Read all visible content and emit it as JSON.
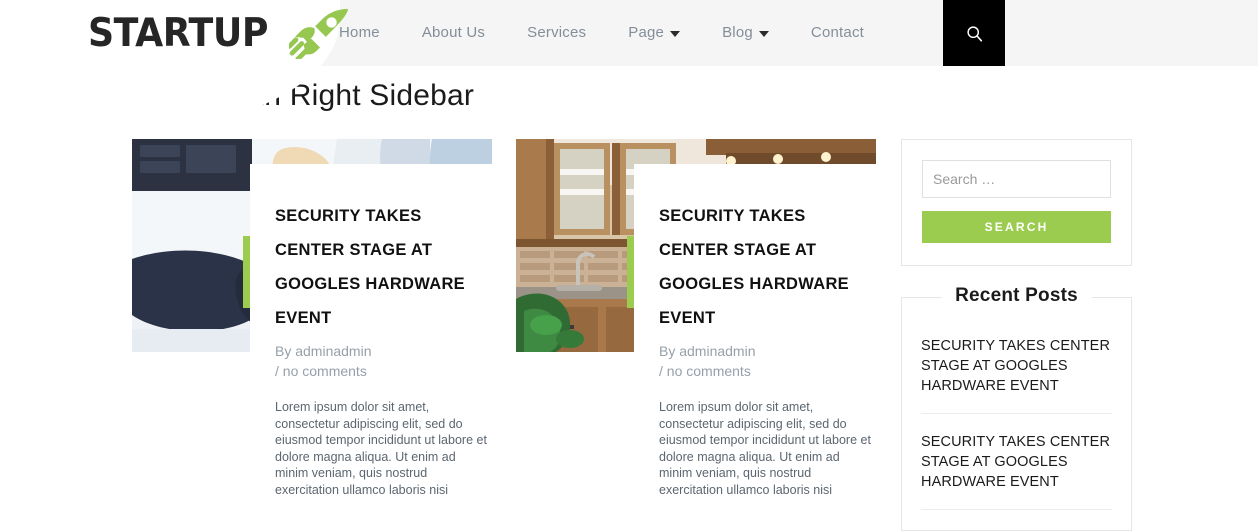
{
  "header": {
    "logo_text": "STARTUP",
    "logo_icon": "rocket-icon",
    "nav": [
      {
        "label": "Home",
        "has_dropdown": false
      },
      {
        "label": "About Us",
        "has_dropdown": false
      },
      {
        "label": "Services",
        "has_dropdown": false
      },
      {
        "label": "Page",
        "has_dropdown": true
      },
      {
        "label": "Blog",
        "has_dropdown": true
      },
      {
        "label": "Contact",
        "has_dropdown": false
      }
    ],
    "search_icon": "search-icon",
    "background_color": "#F5F5F5",
    "search_button_color": "#000000"
  },
  "page": {
    "title": "Blog With Right Sidebar",
    "accent_color": "#9BCC50"
  },
  "posts": [
    {
      "image": "business-handshake-photo",
      "title": "SECURITY TAKES CENTER STAGE AT GOOGLES HARDWARE EVENT",
      "meta": "By adminadmin / no comments",
      "author": "By adminadmin",
      "comments": "/ no comments",
      "excerpt": "Lorem ipsum dolor sit amet, consectetur adipiscing elit, sed do eiusmod tempor incididunt ut labore et dolore magna aliqua. Ut enim ad minim veniam, quis nostrud exercitation ullamco laboris nisi"
    },
    {
      "image": "kitchen-interior-photo",
      "title": "SECURITY TAKES CENTER STAGE AT GOOGLES HARDWARE EVENT",
      "meta": "By adminadmin / no comments",
      "author": "By adminadmin",
      "comments": "/ no comments",
      "excerpt": "Lorem ipsum dolor sit amet, consectetur adipiscing elit, sed do eiusmod tempor incididunt ut labore et dolore magna aliqua. Ut enim ad minim veniam, quis nostrud exercitation ullamco laboris nisi"
    }
  ],
  "sidebar": {
    "search_widget": {
      "placeholder": "Search …",
      "value": "",
      "button_label": "SEARCH",
      "button_color": "#9BCC50"
    },
    "recent_widget": {
      "title": "Recent Posts",
      "items": [
        {
          "title": "SECURITY TAKES CENTER STAGE AT GOOGLES HARDWARE EVENT"
        },
        {
          "title": "SECURITY TAKES CENTER STAGE AT GOOGLES HARDWARE EVENT"
        }
      ]
    }
  }
}
